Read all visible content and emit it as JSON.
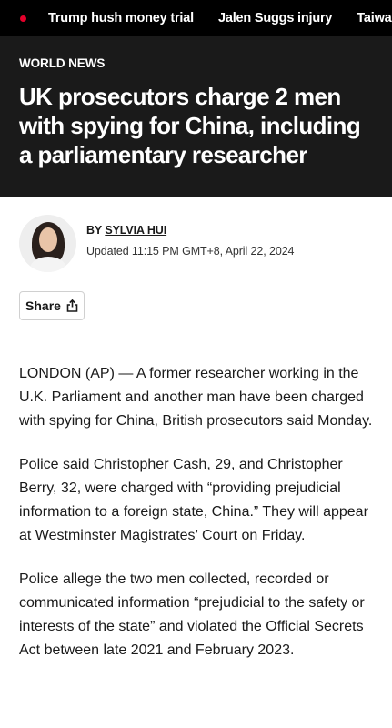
{
  "trending": {
    "live_dot_color": "#e4002b",
    "items": [
      "Trump hush money trial",
      "Jalen Suggs injury",
      "Taiwan earthquake"
    ]
  },
  "article": {
    "section": "WORLD NEWS",
    "headline": "UK prosecutors charge 2 men with spying for China, including a parliamentary researcher",
    "byline_prefix": "BY",
    "author": "SYLVIA HUI",
    "updated": "Updated 11:15 PM GMT+8, April 22, 2024",
    "share_label": "Share",
    "paragraphs": [
      "LONDON (AP) — A former researcher working in the U.K. Parliament and another man have been charged with spying for China, British prosecutors said Monday.",
      "Police said Christopher Cash, 29, and Christopher Berry, 32, were charged with “providing prejudicial information to a foreign state, China.” They will appear at Westminster Magistrates’ Court on Friday.",
      "Police allege the two men collected, recorded or communicated information “prejudicial to the safety or interests of the state” and violated the Official Secrets Act between late 2021 and February 2023."
    ]
  }
}
